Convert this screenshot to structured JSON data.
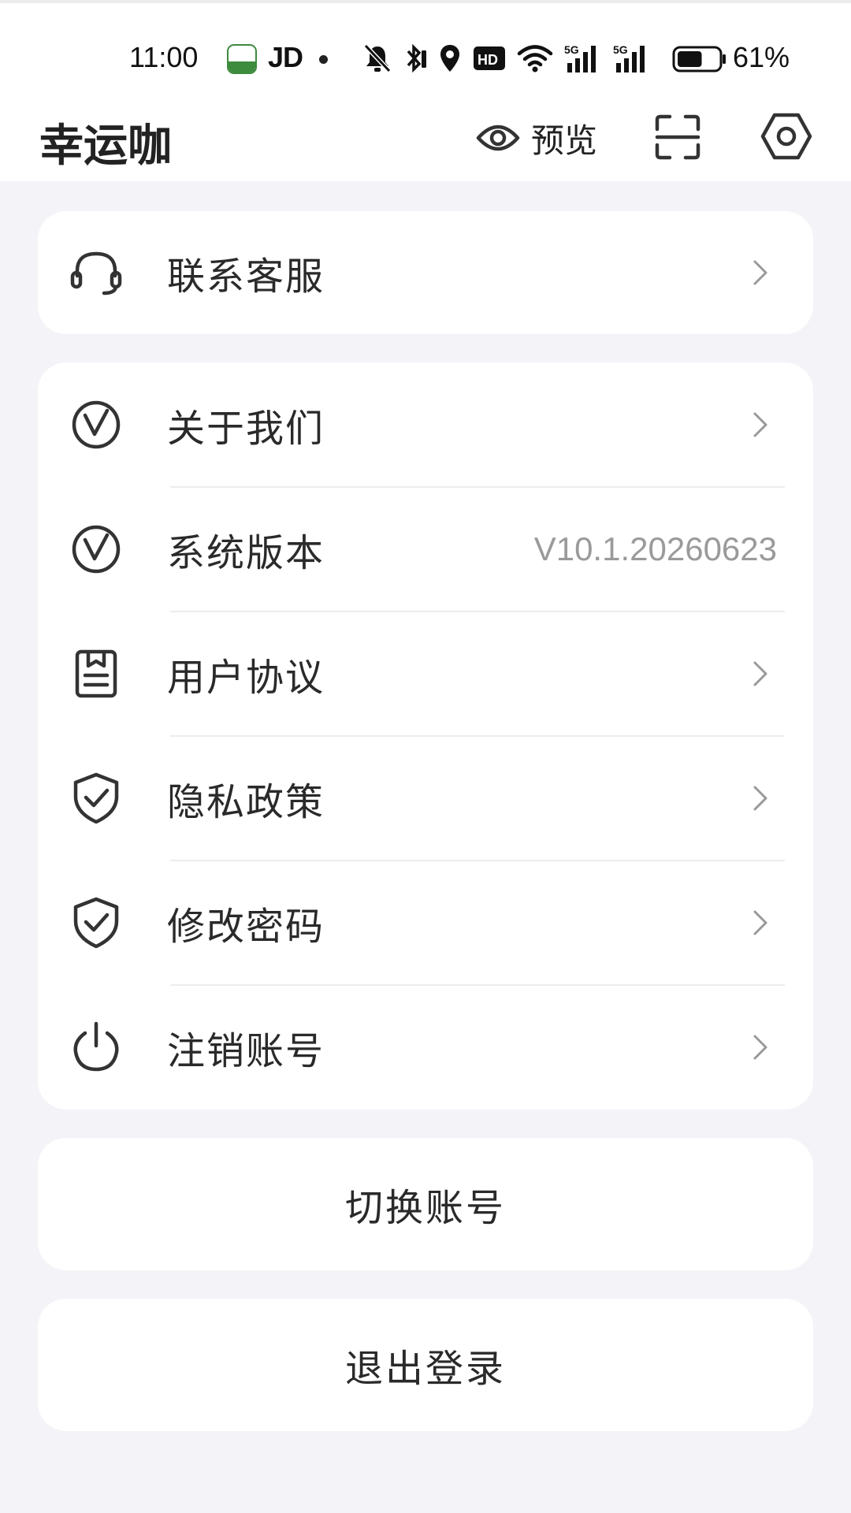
{
  "status_bar": {
    "time": "11:00",
    "carrier": "JD",
    "battery_pct": "61%",
    "battery_level": 0.61,
    "icons": [
      "oppo-app-icon",
      "mute-icon",
      "bluetooth-icon",
      "location-icon",
      "hd-icon",
      "wifi-icon",
      "5g-signal-icon",
      "5g-signal-icon",
      "battery-icon"
    ]
  },
  "header": {
    "title": "幸运咖",
    "preview_label": "预览"
  },
  "support_card": {
    "label": "联系客服"
  },
  "menu": {
    "items": [
      {
        "label": "关于我们",
        "icon": "v-circle-icon"
      },
      {
        "label": "系统版本",
        "icon": "v-circle-icon",
        "value": "V10.1.20260623"
      },
      {
        "label": "用户协议",
        "icon": "document-icon"
      },
      {
        "label": "隐私政策",
        "icon": "shield-check-icon"
      },
      {
        "label": "修改密码",
        "icon": "shield-check-icon"
      },
      {
        "label": "注销账号",
        "icon": "power-icon"
      }
    ]
  },
  "actions": {
    "switch_account": "切换账号",
    "logout": "退出登录"
  },
  "colors": {
    "background": "#f4f4f8",
    "card": "#ffffff",
    "text": "#2a2a2a",
    "muted": "#9a9a9a"
  }
}
